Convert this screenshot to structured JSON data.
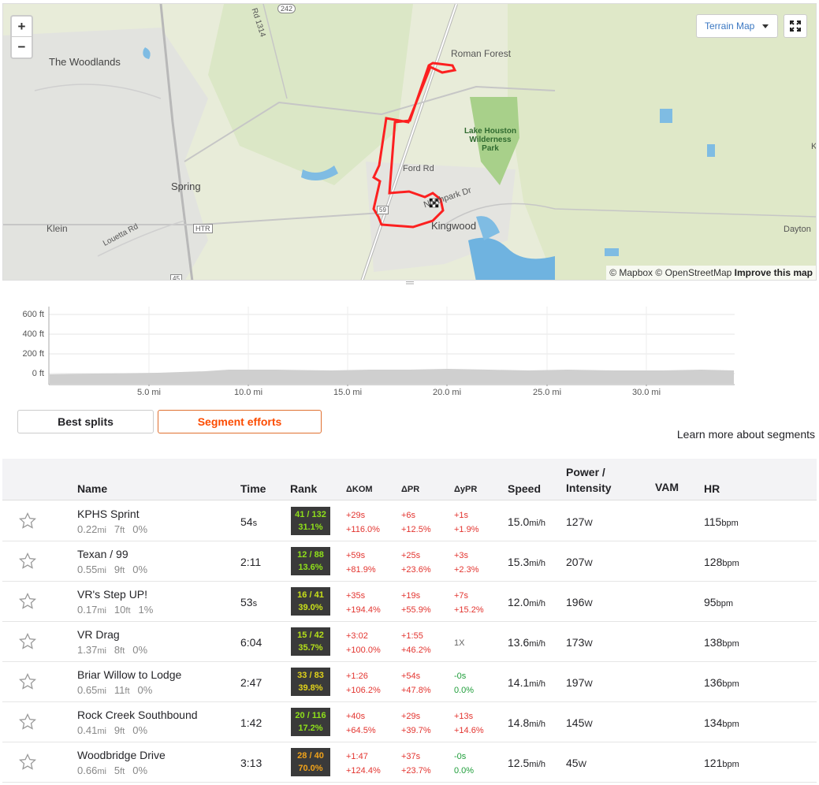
{
  "map": {
    "zoom_in": "+",
    "zoom_out": "−",
    "map_type": "Terrain Map",
    "attribution_mapbox": "© Mapbox",
    "attribution_osm": "© OpenStreetMap",
    "attribution_improve": "Improve this map",
    "labels": {
      "woodlands": "The Woodlands",
      "roman_forest": "Roman Forest",
      "spring": "Spring",
      "klein": "Klein",
      "kingwood": "Kingwood",
      "dayton": "Dayton",
      "ford_rd": "Ford Rd",
      "northpark": "Northpark Dr",
      "louetta": "Louetta Rd",
      "park_1": "Lake Houston",
      "park_2": "Wilderness",
      "park_3": "Park",
      "rd_1314": "Rd 1314",
      "shield_242": "242",
      "shield_htr": "HTR",
      "shield_45": "45",
      "shield_59": "59",
      "edge_k": "K"
    }
  },
  "elevation": {
    "y_labels": [
      "600 ft",
      "400 ft",
      "200 ft",
      "0 ft"
    ],
    "x_labels": [
      "5.0 mi",
      "10.0 mi",
      "15.0 mi",
      "20.0 mi",
      "25.0 mi",
      "30.0 mi"
    ]
  },
  "tabs": {
    "best_splits": "Best splits",
    "segment_efforts": "Segment efforts",
    "learn_more": "Learn more about segments"
  },
  "table": {
    "headers": {
      "name": "Name",
      "time": "Time",
      "rank": "Rank",
      "dkom": "ΔKOM",
      "dpr": "ΔPR",
      "dypr": "ΔyPR",
      "speed": "Speed",
      "power_1": "Power /",
      "power_2": "Intensity",
      "vam": "VAM",
      "hr": "HR"
    },
    "rows": [
      {
        "name": "KPHS Sprint",
        "dist": "0.22",
        "dist_u": "mi",
        "elev": "7",
        "elev_u": "ft",
        "grade": "0%",
        "time": "54",
        "time_u": "s",
        "rank": "41 / 132",
        "pct": "31.1%",
        "rank_color": "#8fe01a",
        "kom_t": "+29s",
        "kom_p": "+116.0%",
        "pr_t": "+6s",
        "pr_p": "+12.5%",
        "ypr_t": "+1s",
        "ypr_p": "+1.9%",
        "ypr_cls": "red",
        "speed": "15.0",
        "speed_u": "mi/h",
        "power": "127",
        "power_u": "W",
        "hr": "115",
        "hr_u": "bpm"
      },
      {
        "name": "Texan / 99",
        "dist": "0.55",
        "dist_u": "mi",
        "elev": "9",
        "elev_u": "ft",
        "grade": "0%",
        "time": "2:11",
        "time_u": "",
        "rank": "12 / 88",
        "pct": "13.6%",
        "rank_color": "#8fe01a",
        "kom_t": "+59s",
        "kom_p": "+81.9%",
        "pr_t": "+25s",
        "pr_p": "+23.6%",
        "ypr_t": "+3s",
        "ypr_p": "+2.3%",
        "ypr_cls": "red",
        "speed": "15.3",
        "speed_u": "mi/h",
        "power": "207",
        "power_u": "W",
        "hr": "128",
        "hr_u": "bpm"
      },
      {
        "name": "VR's Step UP!",
        "dist": "0.17",
        "dist_u": "mi",
        "elev": "10",
        "elev_u": "ft",
        "grade": "1%",
        "time": "53",
        "time_u": "s",
        "rank": "16 / 41",
        "pct": "39.0%",
        "rank_color": "#c8e01a",
        "kom_t": "+35s",
        "kom_p": "+194.4%",
        "pr_t": "+19s",
        "pr_p": "+55.9%",
        "ypr_t": "+7s",
        "ypr_p": "+15.2%",
        "ypr_cls": "red",
        "speed": "12.0",
        "speed_u": "mi/h",
        "power": "196",
        "power_u": "W",
        "hr": "95",
        "hr_u": "bpm"
      },
      {
        "name": "VR Drag",
        "dist": "1.37",
        "dist_u": "mi",
        "elev": "8",
        "elev_u": "ft",
        "grade": "0%",
        "time": "6:04",
        "time_u": "",
        "rank": "15 / 42",
        "pct": "35.7%",
        "rank_color": "#b5e01a",
        "kom_t": "+3:02",
        "kom_p": "+100.0%",
        "pr_t": "+1:55",
        "pr_p": "+46.2%",
        "ypr_t": "1X",
        "ypr_p": "",
        "ypr_cls": "gry",
        "speed": "13.6",
        "speed_u": "mi/h",
        "power": "173",
        "power_u": "W",
        "hr": "138",
        "hr_u": "bpm"
      },
      {
        "name": "Briar Willow to Lodge",
        "dist": "0.65",
        "dist_u": "mi",
        "elev": "11",
        "elev_u": "ft",
        "grade": "0%",
        "time": "2:47",
        "time_u": "",
        "rank": "33 / 83",
        "pct": "39.8%",
        "rank_color": "#e0d21a",
        "kom_t": "+1:26",
        "kom_p": "+106.2%",
        "pr_t": "+54s",
        "pr_p": "+47.8%",
        "ypr_t": "-0s",
        "ypr_p": "0.0%",
        "ypr_cls": "grn",
        "speed": "14.1",
        "speed_u": "mi/h",
        "power": "197",
        "power_u": "W",
        "hr": "136",
        "hr_u": "bpm"
      },
      {
        "name": "Rock Creek Southbound",
        "dist": "0.41",
        "dist_u": "mi",
        "elev": "9",
        "elev_u": "ft",
        "grade": "0%",
        "time": "1:42",
        "time_u": "",
        "rank": "20 / 116",
        "pct": "17.2%",
        "rank_color": "#8fe01a",
        "kom_t": "+40s",
        "kom_p": "+64.5%",
        "pr_t": "+29s",
        "pr_p": "+39.7%",
        "ypr_t": "+13s",
        "ypr_p": "+14.6%",
        "ypr_cls": "red",
        "speed": "14.8",
        "speed_u": "mi/h",
        "power": "145",
        "power_u": "W",
        "hr": "134",
        "hr_u": "bpm"
      },
      {
        "name": "Woodbridge Drive",
        "dist": "0.66",
        "dist_u": "mi",
        "elev": "5",
        "elev_u": "ft",
        "grade": "0%",
        "time": "3:13",
        "time_u": "",
        "rank": "28 / 40",
        "pct": "70.0%",
        "rank_color": "#f0a21a",
        "kom_t": "+1:47",
        "kom_p": "+124.4%",
        "pr_t": "+37s",
        "pr_p": "+23.7%",
        "ypr_t": "-0s",
        "ypr_p": "0.0%",
        "ypr_cls": "grn",
        "speed": "12.5",
        "speed_u": "mi/h",
        "power": "45",
        "power_u": "W",
        "hr": "121",
        "hr_u": "bpm"
      }
    ]
  }
}
